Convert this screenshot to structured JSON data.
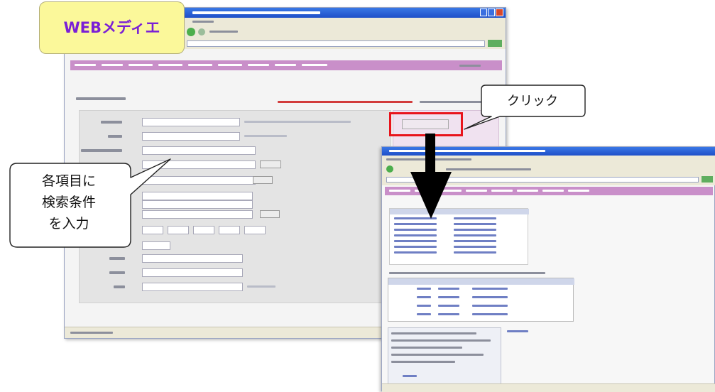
{
  "title_label": "WEBメディエ",
  "callout_click": "クリック",
  "callout_input": [
    "各項目に",
    "検索条件",
    "を入力"
  ],
  "colors": {
    "title_bg": "#fbf89a",
    "title_text": "#7a1fd6",
    "highlight": "#e8141c",
    "xp_title": "#2d5fd8",
    "nav_band": "#c98fc9"
  }
}
